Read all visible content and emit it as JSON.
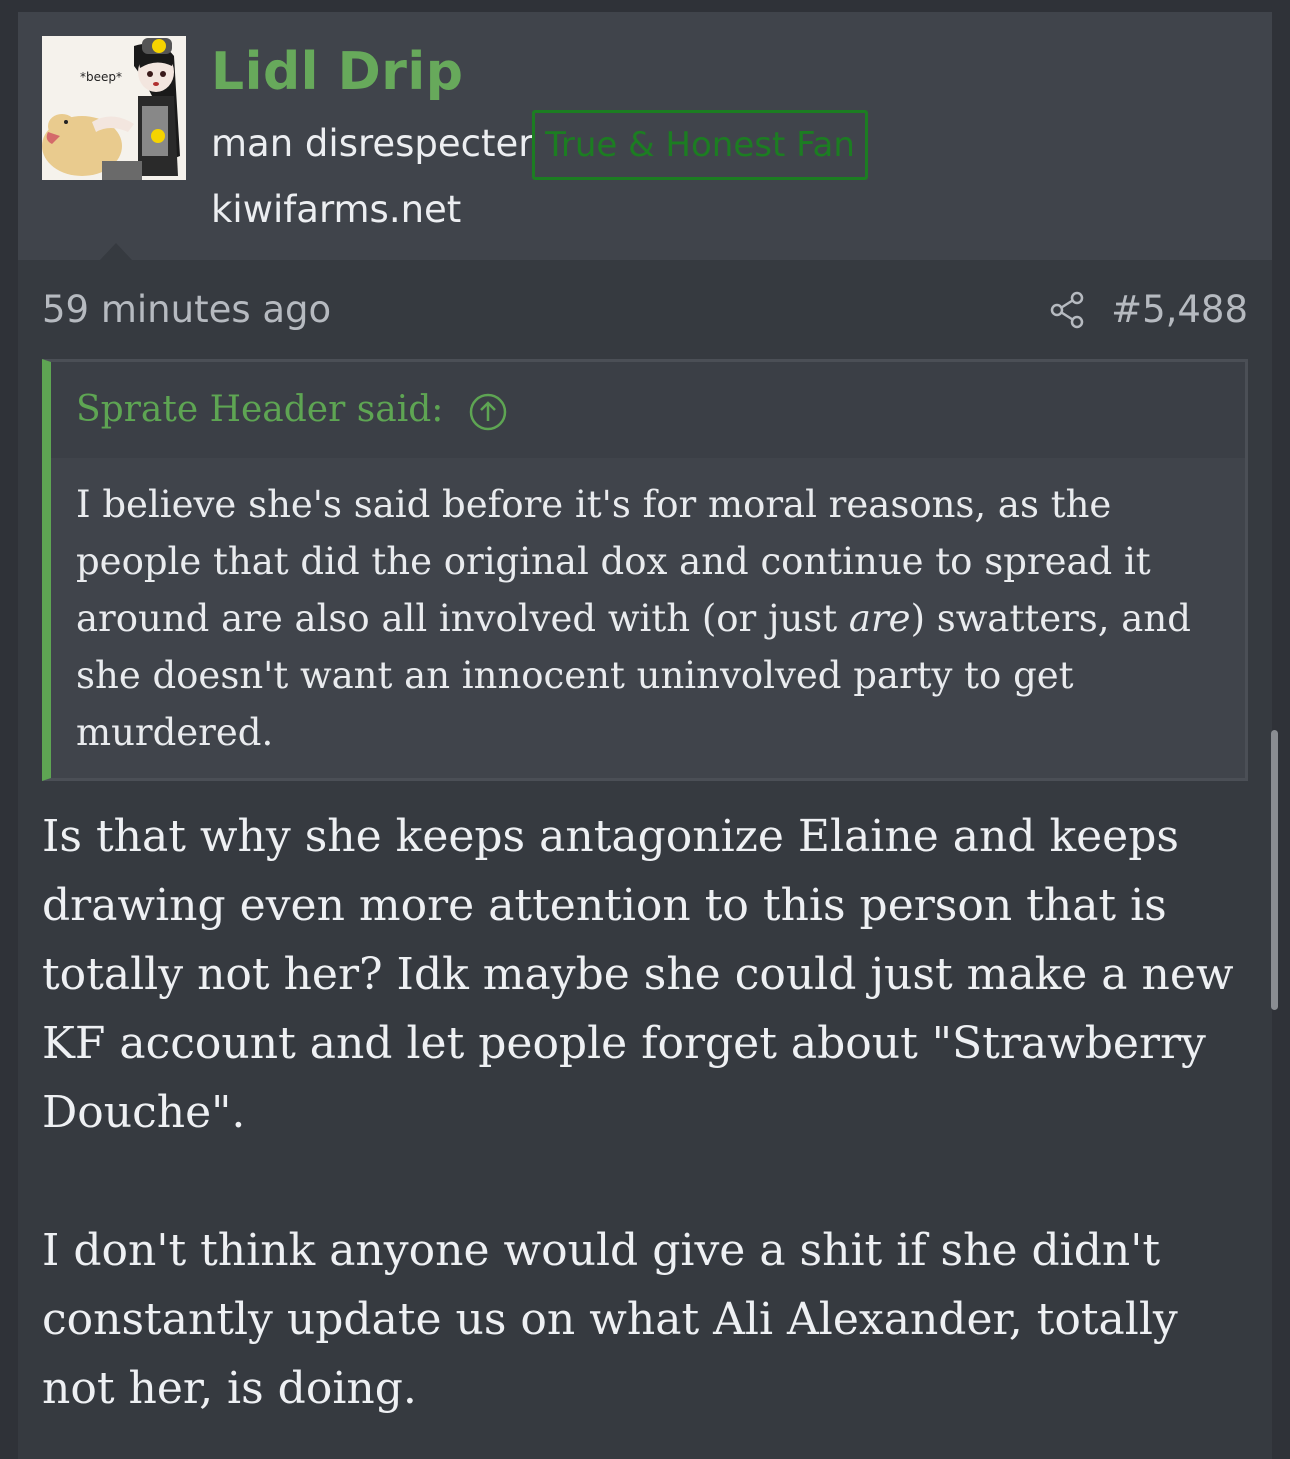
{
  "user": {
    "name": "Lidl Drip",
    "title": "man disrespecter",
    "badge": "True & Honest Fan",
    "site": "kiwifarms.net",
    "avatar_caption": "*beep*"
  },
  "meta": {
    "timestamp": "59 minutes ago",
    "post_number": "#5,488"
  },
  "quote": {
    "author": "Sprate Header said:",
    "text_before": "I believe she's said before it's for moral reasons, as the people that did the original dox and continue to spread it around are also all involved with (or just ",
    "text_italic": "are",
    "text_after": ") swatters, and she doesn't want an innocent uninvolved party to get murdered."
  },
  "body": {
    "paragraph_1": "Is that why she keeps antagonize Elaine and keeps drawing even more attention to this person that is totally not her? Idk maybe she could just make a new KF account and let people forget about \"Strawberry Douche\".",
    "paragraph_2": "I don't think anyone would give a shit if she didn't constantly update us on what Ali Alexander, totally not her, is doing."
  },
  "colors": {
    "accent_green": "#67a95b",
    "badge_green": "#1c7d22",
    "quote_bar": "#5ea553",
    "background": "#363a40"
  }
}
